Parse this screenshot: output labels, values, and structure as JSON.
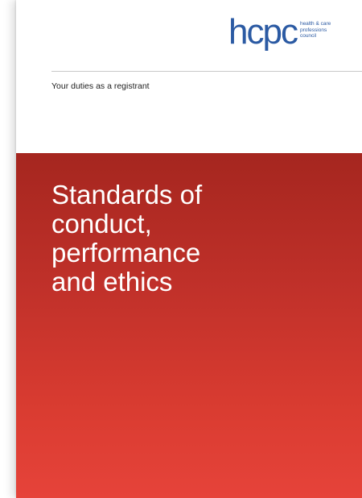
{
  "logo": {
    "wordmark": "hcpc",
    "tagline": [
      "health & care",
      "professions",
      "council"
    ]
  },
  "header": {
    "subtitle": "Your duties as a registrant"
  },
  "cover": {
    "title_lines": [
      "Standards of",
      "conduct,",
      "performance",
      "and ethics"
    ]
  },
  "colors": {
    "brand_blue": "#2b5aa3",
    "panel_top": "#a5261f",
    "panel_bottom": "#e6433a"
  }
}
